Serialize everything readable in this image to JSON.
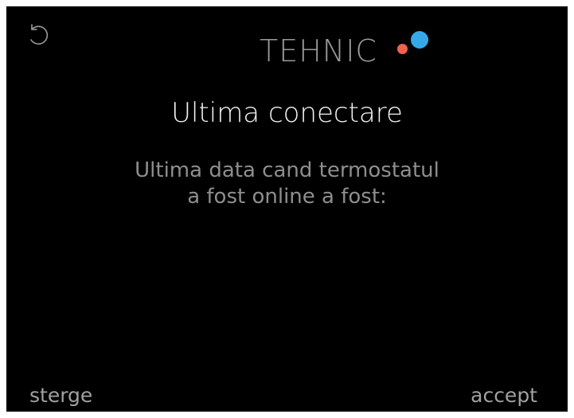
{
  "header": {
    "title": "TEHNIC",
    "back_icon": "undo-arrow-icon",
    "status_dots": {
      "red_color": "#f0614e",
      "blue_color": "#35a8e8"
    }
  },
  "screen": {
    "title": "Ultima conectare",
    "description_line1": "Ultima data cand termostatul",
    "description_line2": "a fost online a fost:"
  },
  "actions": {
    "left_label": "sterge",
    "right_label": "accept"
  },
  "colors": {
    "background": "#000000",
    "title_text": "#f2f2f2",
    "muted_text": "#8e8e8e"
  }
}
